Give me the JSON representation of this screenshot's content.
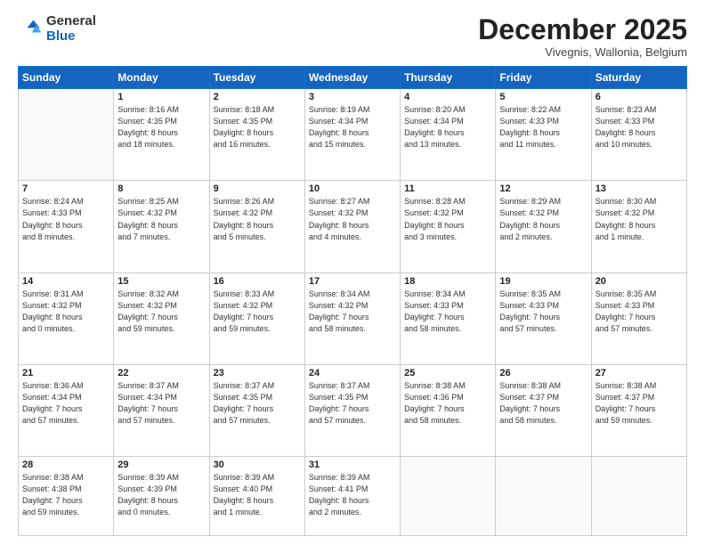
{
  "header": {
    "logo_general": "General",
    "logo_blue": "Blue",
    "month_title": "December 2025",
    "location": "Vivegnis, Wallonia, Belgium"
  },
  "weekdays": [
    "Sunday",
    "Monday",
    "Tuesday",
    "Wednesday",
    "Thursday",
    "Friday",
    "Saturday"
  ],
  "weeks": [
    [
      {
        "day": "",
        "info": ""
      },
      {
        "day": "1",
        "info": "Sunrise: 8:16 AM\nSunset: 4:35 PM\nDaylight: 8 hours\nand 18 minutes."
      },
      {
        "day": "2",
        "info": "Sunrise: 8:18 AM\nSunset: 4:35 PM\nDaylight: 8 hours\nand 16 minutes."
      },
      {
        "day": "3",
        "info": "Sunrise: 8:19 AM\nSunset: 4:34 PM\nDaylight: 8 hours\nand 15 minutes."
      },
      {
        "day": "4",
        "info": "Sunrise: 8:20 AM\nSunset: 4:34 PM\nDaylight: 8 hours\nand 13 minutes."
      },
      {
        "day": "5",
        "info": "Sunrise: 8:22 AM\nSunset: 4:33 PM\nDaylight: 8 hours\nand 11 minutes."
      },
      {
        "day": "6",
        "info": "Sunrise: 8:23 AM\nSunset: 4:33 PM\nDaylight: 8 hours\nand 10 minutes."
      }
    ],
    [
      {
        "day": "7",
        "info": "Sunrise: 8:24 AM\nSunset: 4:33 PM\nDaylight: 8 hours\nand 8 minutes."
      },
      {
        "day": "8",
        "info": "Sunrise: 8:25 AM\nSunset: 4:32 PM\nDaylight: 8 hours\nand 7 minutes."
      },
      {
        "day": "9",
        "info": "Sunrise: 8:26 AM\nSunset: 4:32 PM\nDaylight: 8 hours\nand 5 minutes."
      },
      {
        "day": "10",
        "info": "Sunrise: 8:27 AM\nSunset: 4:32 PM\nDaylight: 8 hours\nand 4 minutes."
      },
      {
        "day": "11",
        "info": "Sunrise: 8:28 AM\nSunset: 4:32 PM\nDaylight: 8 hours\nand 3 minutes."
      },
      {
        "day": "12",
        "info": "Sunrise: 8:29 AM\nSunset: 4:32 PM\nDaylight: 8 hours\nand 2 minutes."
      },
      {
        "day": "13",
        "info": "Sunrise: 8:30 AM\nSunset: 4:32 PM\nDaylight: 8 hours\nand 1 minute."
      }
    ],
    [
      {
        "day": "14",
        "info": "Sunrise: 8:31 AM\nSunset: 4:32 PM\nDaylight: 8 hours\nand 0 minutes."
      },
      {
        "day": "15",
        "info": "Sunrise: 8:32 AM\nSunset: 4:32 PM\nDaylight: 7 hours\nand 59 minutes."
      },
      {
        "day": "16",
        "info": "Sunrise: 8:33 AM\nSunset: 4:32 PM\nDaylight: 7 hours\nand 59 minutes."
      },
      {
        "day": "17",
        "info": "Sunrise: 8:34 AM\nSunset: 4:32 PM\nDaylight: 7 hours\nand 58 minutes."
      },
      {
        "day": "18",
        "info": "Sunrise: 8:34 AM\nSunset: 4:33 PM\nDaylight: 7 hours\nand 58 minutes."
      },
      {
        "day": "19",
        "info": "Sunrise: 8:35 AM\nSunset: 4:33 PM\nDaylight: 7 hours\nand 57 minutes."
      },
      {
        "day": "20",
        "info": "Sunrise: 8:35 AM\nSunset: 4:33 PM\nDaylight: 7 hours\nand 57 minutes."
      }
    ],
    [
      {
        "day": "21",
        "info": "Sunrise: 8:36 AM\nSunset: 4:34 PM\nDaylight: 7 hours\nand 57 minutes."
      },
      {
        "day": "22",
        "info": "Sunrise: 8:37 AM\nSunset: 4:34 PM\nDaylight: 7 hours\nand 57 minutes."
      },
      {
        "day": "23",
        "info": "Sunrise: 8:37 AM\nSunset: 4:35 PM\nDaylight: 7 hours\nand 57 minutes."
      },
      {
        "day": "24",
        "info": "Sunrise: 8:37 AM\nSunset: 4:35 PM\nDaylight: 7 hours\nand 57 minutes."
      },
      {
        "day": "25",
        "info": "Sunrise: 8:38 AM\nSunset: 4:36 PM\nDaylight: 7 hours\nand 58 minutes."
      },
      {
        "day": "26",
        "info": "Sunrise: 8:38 AM\nSunset: 4:37 PM\nDaylight: 7 hours\nand 58 minutes."
      },
      {
        "day": "27",
        "info": "Sunrise: 8:38 AM\nSunset: 4:37 PM\nDaylight: 7 hours\nand 59 minutes."
      }
    ],
    [
      {
        "day": "28",
        "info": "Sunrise: 8:38 AM\nSunset: 4:38 PM\nDaylight: 7 hours\nand 59 minutes."
      },
      {
        "day": "29",
        "info": "Sunrise: 8:39 AM\nSunset: 4:39 PM\nDaylight: 8 hours\nand 0 minutes."
      },
      {
        "day": "30",
        "info": "Sunrise: 8:39 AM\nSunset: 4:40 PM\nDaylight: 8 hours\nand 1 minute."
      },
      {
        "day": "31",
        "info": "Sunrise: 8:39 AM\nSunset: 4:41 PM\nDaylight: 8 hours\nand 2 minutes."
      },
      {
        "day": "",
        "info": ""
      },
      {
        "day": "",
        "info": ""
      },
      {
        "day": "",
        "info": ""
      }
    ]
  ]
}
